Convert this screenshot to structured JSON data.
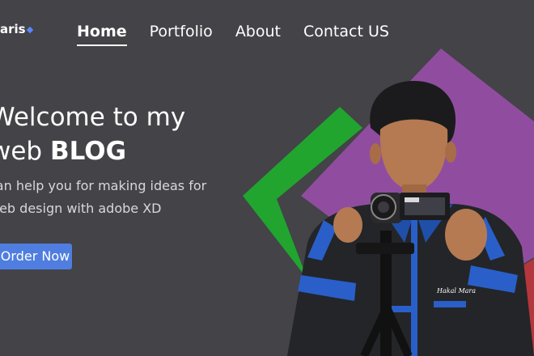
{
  "brand": {
    "text": "aris"
  },
  "nav": [
    {
      "label": "Home",
      "active": true
    },
    {
      "label": "Portfolio",
      "active": false
    },
    {
      "label": "About",
      "active": false
    },
    {
      "label": "Contact US",
      "active": false
    }
  ],
  "hero": {
    "line1": "Welcome to my",
    "line2_prefix": "web ",
    "line2_bold": "BLOG",
    "sub1": "can help you for making ideas for",
    "sub2": "web design with adobe XD",
    "button": "Order Now"
  },
  "photo": {
    "badge_text": "Hakal Mara"
  },
  "colors": {
    "background": "#434348",
    "green": "#21a52f",
    "purple": "#904d9f",
    "button": "#4f7ee0",
    "red": "#b3373d"
  }
}
